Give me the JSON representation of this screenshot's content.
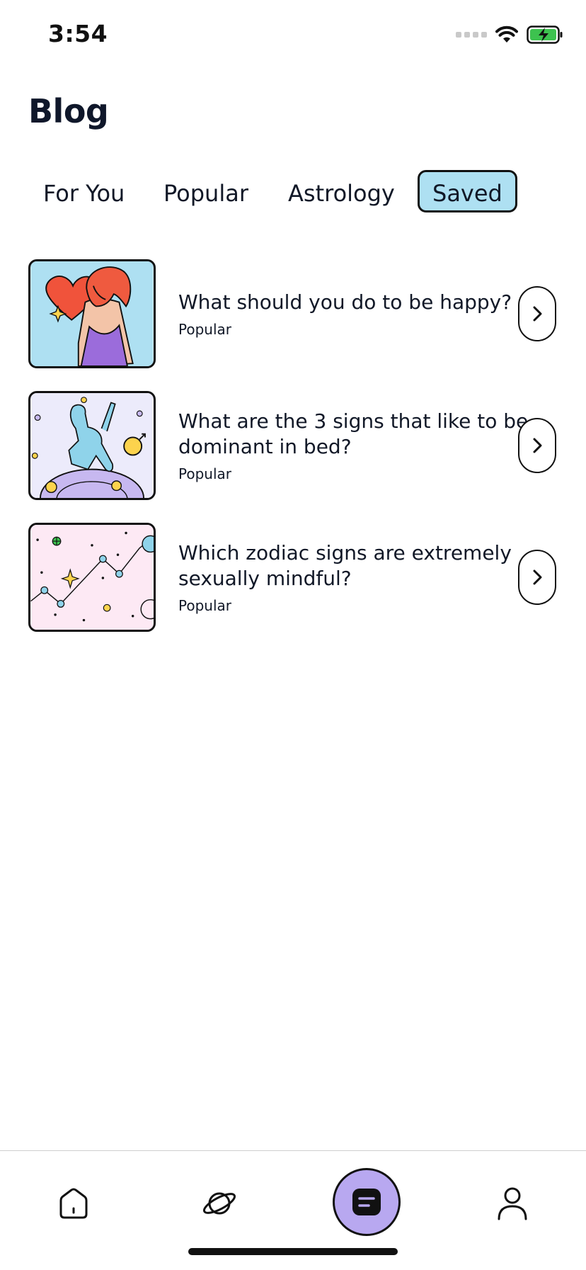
{
  "status_bar": {
    "time": "3:54",
    "icons": [
      "signal-icon",
      "wifi-icon",
      "battery-charging-icon"
    ]
  },
  "page": {
    "title": "Blog"
  },
  "tabs": [
    {
      "label": "For You",
      "active": false
    },
    {
      "label": "Popular",
      "active": false
    },
    {
      "label": "Astrology",
      "active": false
    },
    {
      "label": "Saved",
      "active": true
    }
  ],
  "articles": [
    {
      "title": "What should you do to be happy?",
      "tag": "Popular",
      "thumb_bg": "#aee0f2"
    },
    {
      "title": "What are the 3 signs that like to be dominant in bed?",
      "tag": "Popular",
      "thumb_bg": "#ecebfb"
    },
    {
      "title": "Which zodiac signs are extremely sexually mindful?",
      "tag": "Popular",
      "thumb_bg": "#fde9f4"
    }
  ],
  "bottom_nav": {
    "items": [
      "home-icon",
      "planet-icon",
      "blog-icon",
      "profile-icon"
    ],
    "active": "blog-icon",
    "accent": "#b8a8f0"
  },
  "colors": {
    "tab_active_bg": "#aee0f2",
    "text": "#111827"
  }
}
